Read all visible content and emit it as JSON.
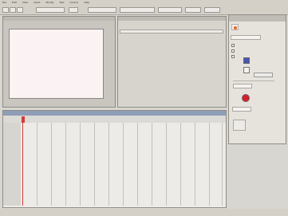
{
  "colors": {
    "swatch_blue": "#4a55b0",
    "swatch_red": "#d81e28",
    "swatch_orange": "#e0662a",
    "timeline_title": "#8e9db8",
    "playhead": "#d33a3a",
    "canvas": "#fbf2f4"
  },
  "icons": [
    "fill-icon",
    "stroke-color-icon",
    "playhead-icon",
    "checkbox-icon"
  ]
}
